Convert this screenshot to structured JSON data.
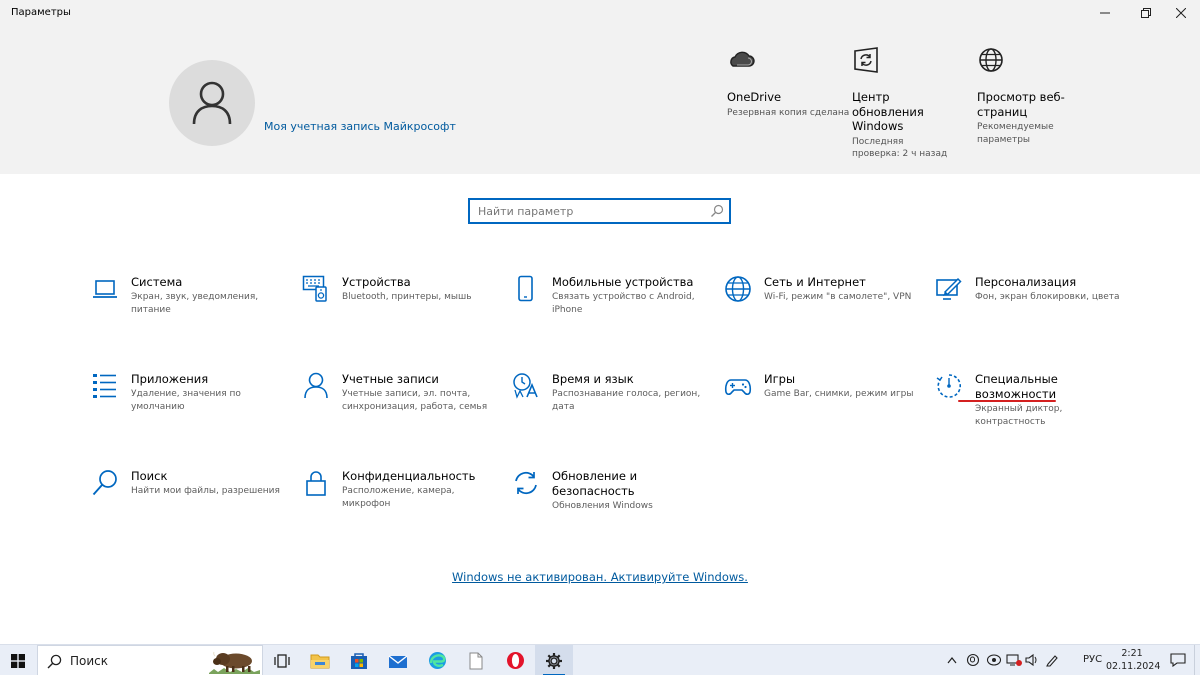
{
  "window": {
    "title": "Параметры",
    "min_glyph": "—",
    "max_glyph": "☐",
    "close_glyph": "✕"
  },
  "header": {
    "account_link": "Моя учетная запись Майкрософт",
    "onedrive": {
      "title": "OneDrive",
      "sub": "Резервная копия сделана"
    },
    "update": {
      "title": "Центр обновления Windows",
      "sub": "Последняя проверка: 2 ч назад"
    },
    "browser": {
      "title": "Просмотр веб-страниц",
      "sub": "Рекомендуемые параметры"
    }
  },
  "search": {
    "placeholder": "Найти параметр"
  },
  "tiles": {
    "system": {
      "title": "Система",
      "sub": "Экран, звук, уведомления, питание",
      "icon": "laptop-icon"
    },
    "devices": {
      "title": "Устройства",
      "sub": "Bluetooth, принтеры, мышь",
      "icon": "devices-icon"
    },
    "phone": {
      "title": "Мобильные устройства",
      "sub": "Связать устройство с Android, iPhone",
      "icon": "phone-icon"
    },
    "network": {
      "title": "Сеть и Интернет",
      "sub": "Wi-Fi, режим \"в самолете\", VPN",
      "icon": "globe-icon"
    },
    "personalization": {
      "title": "Персонализация",
      "sub": "Фон, экран блокировки, цвета",
      "icon": "paint-icon"
    },
    "apps": {
      "title": "Приложения",
      "sub": "Удаление, значения по умолчанию",
      "icon": "apps-list-icon"
    },
    "accounts": {
      "title": "Учетные записи",
      "sub": "Учетные записи, эл. почта, синхронизация, работа, семья",
      "icon": "person-icon"
    },
    "time": {
      "title": "Время и язык",
      "sub": "Распознавание голоса, регион, дата",
      "icon": "time-language-icon"
    },
    "gaming": {
      "title": "Игры",
      "sub": "Game Bar, снимки, режим игры",
      "icon": "gamepad-icon"
    },
    "accessibility": {
      "title": "Специальные возможности",
      "sub": "Экранный диктор, контрастность",
      "icon": "accessibility-icon"
    },
    "search": {
      "title": "Поиск",
      "sub": "Найти мои файлы, разрешения",
      "icon": "search-icon"
    },
    "privacy": {
      "title": "Конфиденциальность",
      "sub": "Расположение, камера, микрофон",
      "icon": "lock-icon"
    },
    "update": {
      "title": "Обновление и безопасность",
      "sub": "Обновления Windows",
      "icon": "sync-icon"
    }
  },
  "activation_link": "Windows не активирован. Активируйте Windows.",
  "taskbar": {
    "search_label": "Поиск",
    "language": "РУС",
    "time": "2:21",
    "date": "02.11.2024"
  },
  "colors": {
    "accent": "#0067c0",
    "link": "#005a9e",
    "header_bg": "#f2f2f2",
    "annotation": "#d42020"
  }
}
